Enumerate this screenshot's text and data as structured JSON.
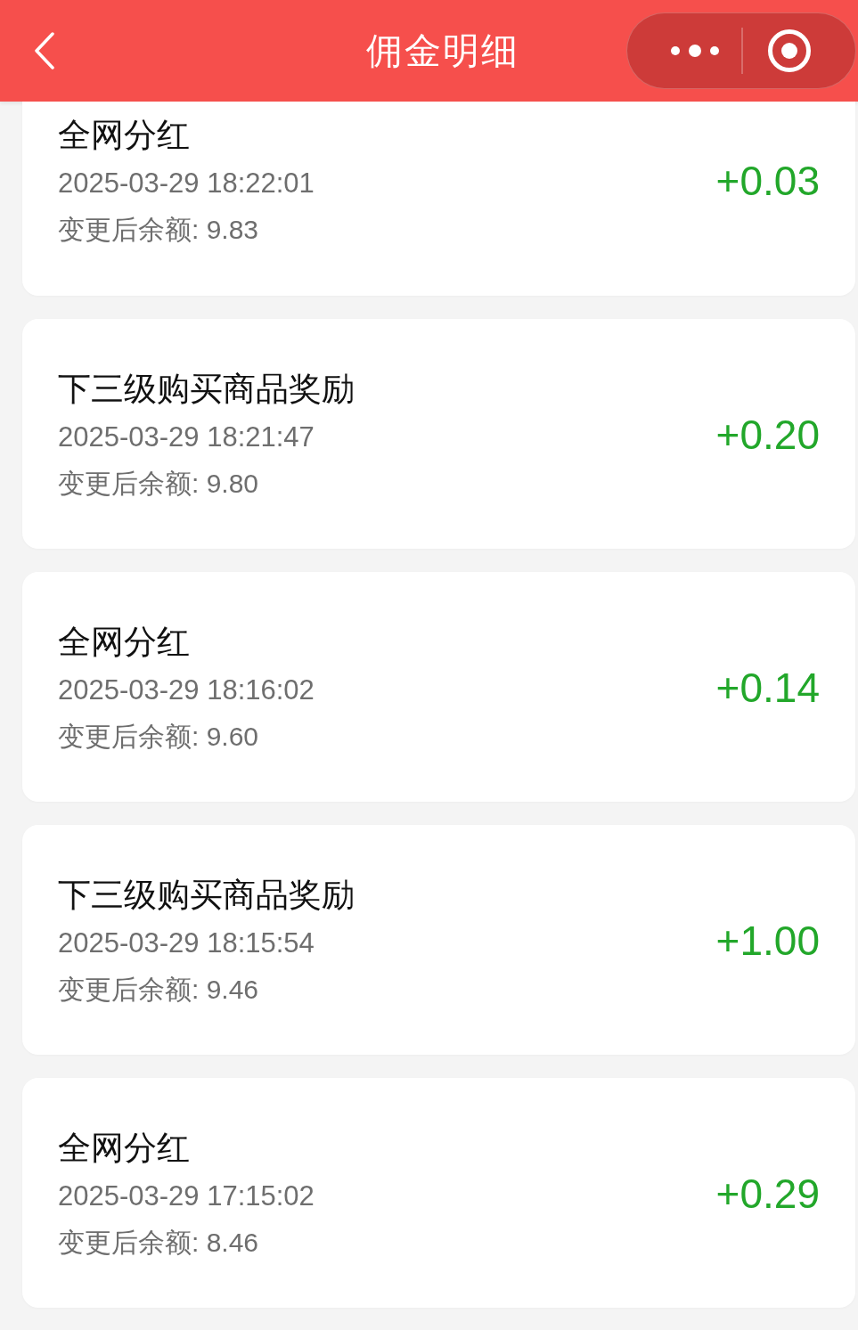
{
  "header": {
    "title": "佣金明细"
  },
  "records": [
    {
      "type": "全网分红",
      "time": "2025-03-29 18:22:01",
      "balance": "变更后余额: 9.83",
      "amount": "+0.03"
    },
    {
      "type": "下三级购买商品奖励",
      "time": "2025-03-29 18:21:47",
      "balance": "变更后余额: 9.80",
      "amount": "+0.20"
    },
    {
      "type": "全网分红",
      "time": "2025-03-29 18:16:02",
      "balance": "变更后余额: 9.60",
      "amount": "+0.14"
    },
    {
      "type": "下三级购买商品奖励",
      "time": "2025-03-29 18:15:54",
      "balance": "变更后余额: 9.46",
      "amount": "+1.00"
    },
    {
      "type": "全网分红",
      "time": "2025-03-29 17:15:02",
      "balance": "变更后余额: 8.46",
      "amount": "+0.29"
    }
  ]
}
